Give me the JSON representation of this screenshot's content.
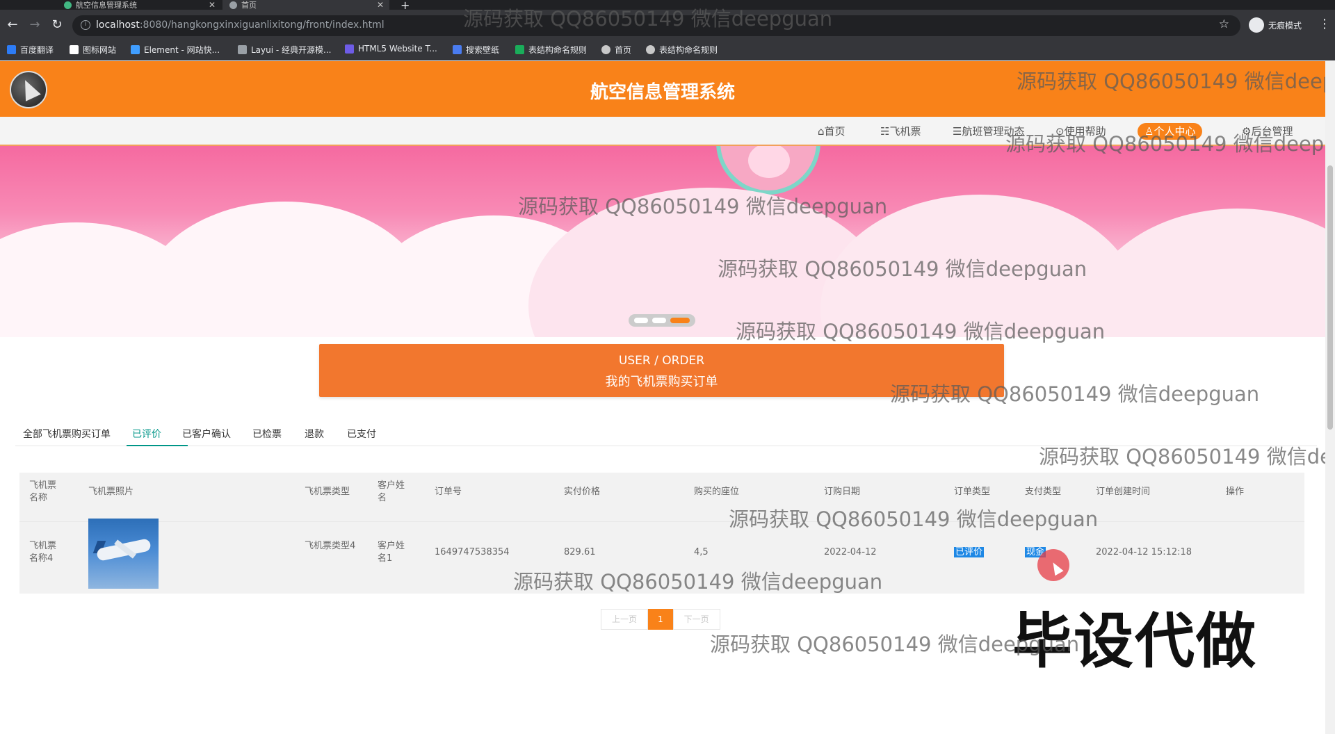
{
  "browser": {
    "tabs": [
      {
        "title": "航空信息管理系统"
      },
      {
        "title": "首页"
      }
    ],
    "new_tab": "+",
    "url_host": "localhost",
    "url_rest": ":8080/hangkongxinxiguanlixitong/front/index.html",
    "profile_label": "无痕模式",
    "bookmarks": [
      {
        "label": "百度翻译",
        "color": "#2d7cf6"
      },
      {
        "label": "图标网站",
        "color": "#ffffff"
      },
      {
        "label": "Element - 网站快...",
        "color": "#409eff"
      },
      {
        "label": "Layui - 经典开源模...",
        "color": "#9aa0a6"
      },
      {
        "label": "HTML5 Website T...",
        "color": "#6e5ce6"
      },
      {
        "label": "搜索壁纸",
        "color": "#4a7cf0"
      },
      {
        "label": "表结构命名规则",
        "color": "#1aad5a"
      },
      {
        "label": "首页",
        "color": "#c8c8c8"
      },
      {
        "label": "表结构命名规则",
        "color": "#c8c8c8"
      }
    ]
  },
  "site": {
    "title": "航空信息管理系统",
    "nav": [
      {
        "label": "⌂首页"
      },
      {
        "label": "☵飞机票"
      },
      {
        "label": "☰航班管理动态"
      },
      {
        "label": "⊙使用帮助"
      },
      {
        "label": "♙个人中心"
      },
      {
        "label": "⚙后台管理"
      }
    ]
  },
  "order_banner": {
    "en": "USER / ORDER",
    "cn": "我的飞机票购买订单"
  },
  "order_tabs": [
    {
      "label": "全部飞机票购买订单"
    },
    {
      "label": "已评价"
    },
    {
      "label": "已客户确认"
    },
    {
      "label": "已检票"
    },
    {
      "label": "退款"
    },
    {
      "label": "已支付"
    }
  ],
  "table": {
    "headers": [
      "飞机票名称",
      "飞机票照片",
      "飞机票类型",
      "客户姓名",
      "订单号",
      "实付价格",
      "购买的座位",
      "订购日期",
      "订单类型",
      "支付类型",
      "订单创建时间",
      "操作"
    ],
    "row": {
      "name": "飞机票名称4",
      "type": "飞机票类型4",
      "customer": "客户姓名1",
      "order_no": "1649747538354",
      "price": "829.61",
      "seat": "4,5",
      "date": "2022-04-12",
      "order_type": "已评价",
      "pay_type": "现金",
      "created": "2022-04-12 15:12:18"
    }
  },
  "pager": {
    "prev": "上一页",
    "current": "1",
    "next": "下一页"
  },
  "promo_text": "毕设代做",
  "watermark": "源码获取 QQ86050149 微信deepguan",
  "watermark_cut_a": "源码获取 QQ86050149 微信deep",
  "watermark_cut_b": "源码获取 QQ86050149 微信de"
}
